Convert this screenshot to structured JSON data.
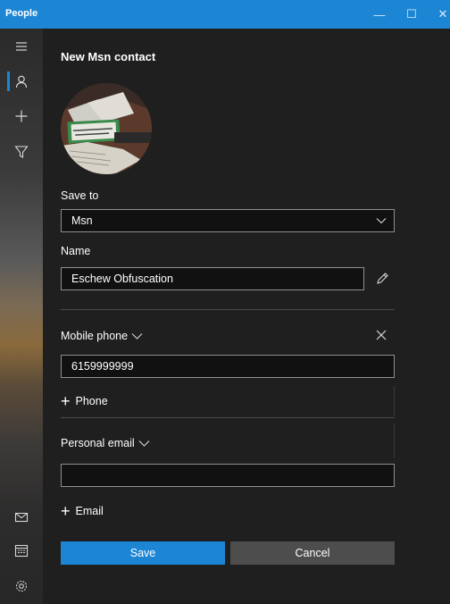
{
  "window": {
    "title": "People",
    "minimize_glyph": "—",
    "maximize_glyph": "☐",
    "close_glyph": "✕"
  },
  "sidebar": {
    "items": [
      {
        "icon": "hamburger-menu-icon"
      },
      {
        "icon": "person-icon",
        "active": true
      },
      {
        "icon": "plus-icon"
      },
      {
        "icon": "filter-icon"
      }
    ],
    "bottom_items": [
      {
        "icon": "mail-icon"
      },
      {
        "icon": "calendar-icon"
      },
      {
        "icon": "settings-icon"
      }
    ]
  },
  "form": {
    "heading": "New Msn contact",
    "save_to_label": "Save to",
    "save_to_value": "Msn",
    "name_label": "Name",
    "name_value": "Eschew Obfuscation",
    "phone_label": "Mobile phone",
    "phone_value": "6159999999",
    "add_phone_label": "Phone",
    "email_label": "Personal email",
    "email_value": "",
    "add_email_label": "Email",
    "save_label": "Save",
    "cancel_label": "Cancel"
  },
  "colors": {
    "accent": "#1d86d4",
    "background": "#1f1f1f",
    "field_bg": "#111111",
    "field_border": "#8f8f8f"
  }
}
